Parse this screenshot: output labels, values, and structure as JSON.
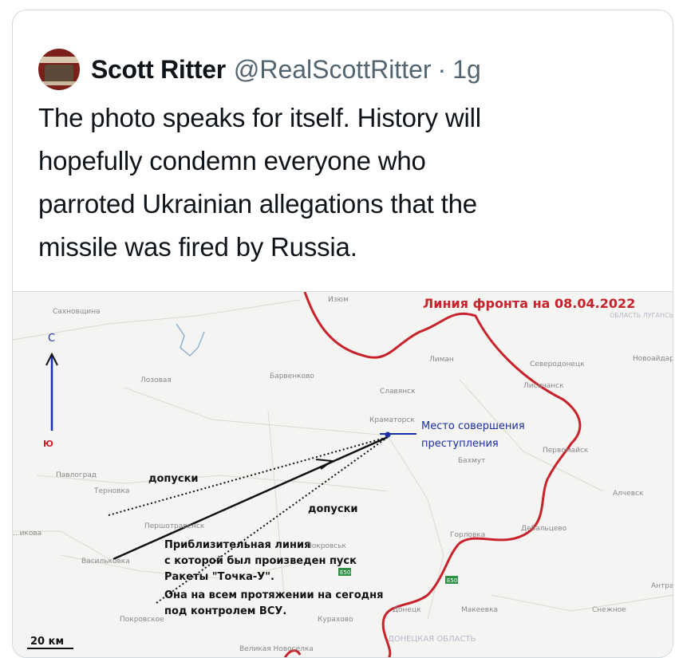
{
  "tweet": {
    "author_name": "Scott Ritter",
    "author_handle": "@RealScottRitter",
    "separator": "·",
    "time": "1g",
    "lines": [
      "The photo speaks for itself. History will",
      "hopefully condemn everyone who",
      "parroted Ukrainian allegations that the",
      "missile was fired by Russia."
    ]
  },
  "map": {
    "title": "Линия фронта на 08.04.2022",
    "compass_n": "С",
    "compass_s": "Ю",
    "label_dopuski_1": "допуски",
    "label_dopuski_2": "допуски",
    "crime_label_1": "Место совершения",
    "crime_label_2": "преступления",
    "note_lines": [
      "Приблизительная линия",
      "с которой был произведен пуск",
      "Ракеты \"Точка-У\".",
      "Она на всем протяжении на сегодня",
      "под контролем ВСУ."
    ],
    "scale": "20 км",
    "towns": {
      "sakhnovshchina": "Сахновщина",
      "izyum": "Изюм",
      "barvenkovo": "Барвенково",
      "lozovaya": "Лозовая",
      "slavyansk": "Славянск",
      "liman": "Лиман",
      "severodonetsk": "Северодонецк",
      "lisichansk": "Лисичанск",
      "novoaydar": "Новоайдар",
      "kramatorsk": "Краматорск",
      "bakhmut": "Бахмут",
      "pervomaysk": "Первомайск",
      "pavlograd": "Павлоград",
      "ternovka": "Терновка",
      "alchevsk": "Алчевск",
      "pershotravensk": "Першотравенск",
      "gorlovka": "Горловка",
      "debaltsevo": "Дебальцево",
      "mezhova": "...икова",
      "vasilkovka": "Васильковка",
      "pokrovsk": "Покровское",
      "kurakhovo": "Курахово",
      "donetsk": "Донецк",
      "makeevka": "Макеевка",
      "snezhnoe": "Снежное",
      "antratsit": "Антрацит",
      "velikaya_novoselka": "Великая Новоселка",
      "lugansk_obl": "ОБЛАСТЬ ЛУГАНСЬКА ОБЛАСТЬ",
      "donetsk_obl": "ДОНЕЦКАЯ ОБЛАСТЬ",
      "road_e50_a": "E50",
      "road_e50_b": "E50",
      "pokrovsk_small": "Покровськ"
    },
    "colors": {
      "front_line": "#c8232c",
      "crime_marker": "#1a2fa8"
    }
  }
}
